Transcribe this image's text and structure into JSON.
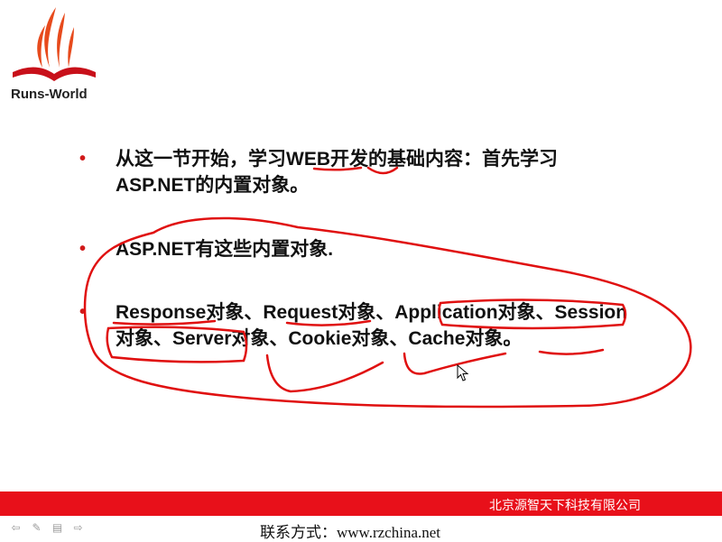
{
  "logo": {
    "text": "Runs-World"
  },
  "slide": {
    "bullets": [
      {
        "marker": "•",
        "text": "从这一节开始，学习WEB开发的基础内容：首先学习ASP.NET的内置对象。"
      },
      {
        "marker": "•",
        "text": "ASP.NET有这些内置对象."
      },
      {
        "marker": "•",
        "text": "Response对象、Request对象、Application对象、Session对象、Server对象、Cookie对象、Cache对象。"
      }
    ]
  },
  "footer": {
    "company": "北京源智天下科技有限公司",
    "contact": "联系方式：www.rzchina.net"
  },
  "nav_icons": [
    "arrow-left-icon",
    "pen-icon",
    "slides-icon",
    "arrow-right-icon"
  ],
  "colors": {
    "accent": "#e8101a",
    "bullet": "#d11a1a",
    "annotation": "#e01010"
  }
}
